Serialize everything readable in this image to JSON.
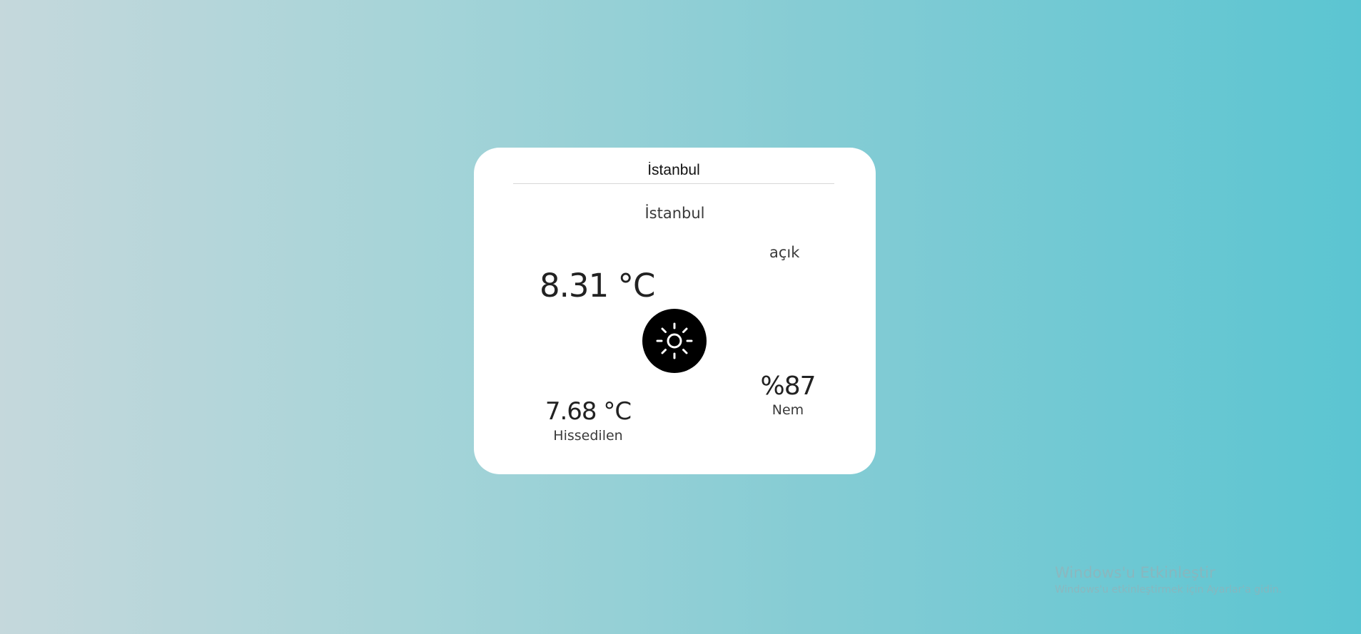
{
  "search": {
    "value": "İstanbul",
    "placeholder": ""
  },
  "weather": {
    "city": "İstanbul",
    "description": "açık",
    "temperature": "8.31 °C",
    "feels_like": "7.68 °C",
    "feels_like_label": "Hissedilen",
    "humidity": "%87",
    "humidity_label": "Nem",
    "icon": "sun-icon"
  },
  "watermark": {
    "title": "Windows'u Etkinleştir",
    "subtitle": "Windows'u etkinleştirmek için Ayarlar'a gidin."
  },
  "colors": {
    "card_background": "#ffffff",
    "icon_background": "#000000",
    "gradient_start": "#c5d8dc",
    "gradient_end": "#5bc5d2"
  }
}
